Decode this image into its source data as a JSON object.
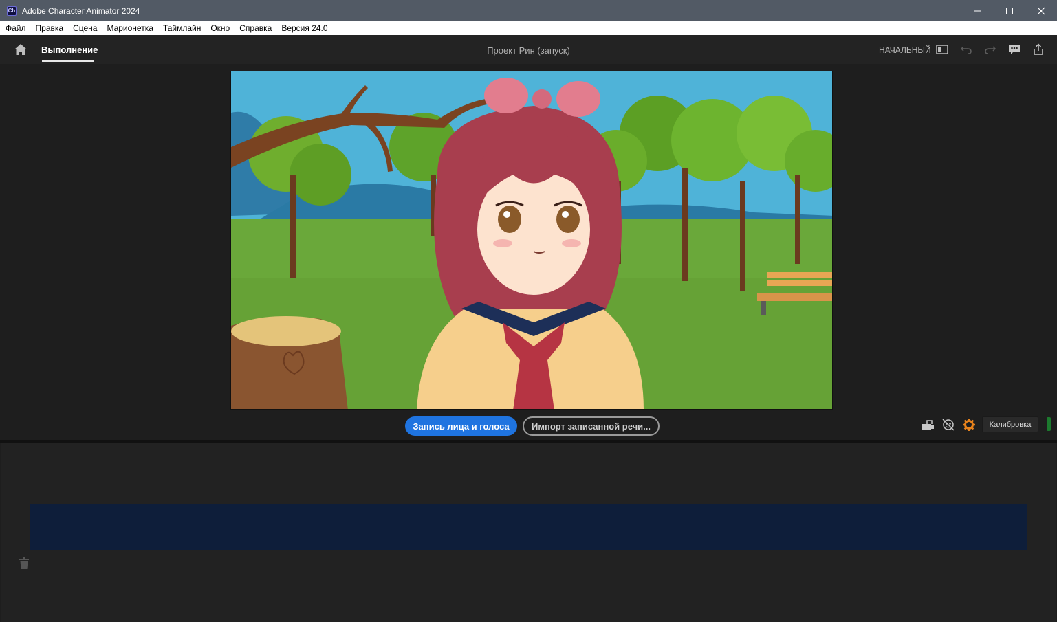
{
  "window": {
    "app_icon_text": "Ch",
    "title": "Adobe Character Animator 2024",
    "controls": [
      "minimize-icon",
      "maximize-icon",
      "close-icon"
    ]
  },
  "menubar": {
    "items": [
      "Файл",
      "Правка",
      "Сцена",
      "Марионетка",
      "Таймлайн",
      "Окно",
      "Справка",
      "Версия 24.0"
    ]
  },
  "header": {
    "home_icon": "home-icon",
    "tab_label": "Выполнение",
    "project_title": "Проект Рин (запуск)",
    "workspace_label": "НАЧАЛЬНЫЙ",
    "icons": [
      "panel-layout-icon",
      "undo-icon",
      "redo-icon",
      "comment-icon",
      "share-icon"
    ]
  },
  "controls": {
    "record_label": "Запись лица и голоса",
    "import_label": "Импорт записанной речи...",
    "icons": [
      "camera-off-icon",
      "face-tracking-icon",
      "settings-gear-icon"
    ],
    "calibrate_label": "Калибровка"
  },
  "timeline": {
    "trash_icon": "trash-icon"
  },
  "colors": {
    "accent": "#1f74e0",
    "titlebar": "#525a65",
    "track": "#0e1e3a",
    "gear": "#e8831c"
  }
}
